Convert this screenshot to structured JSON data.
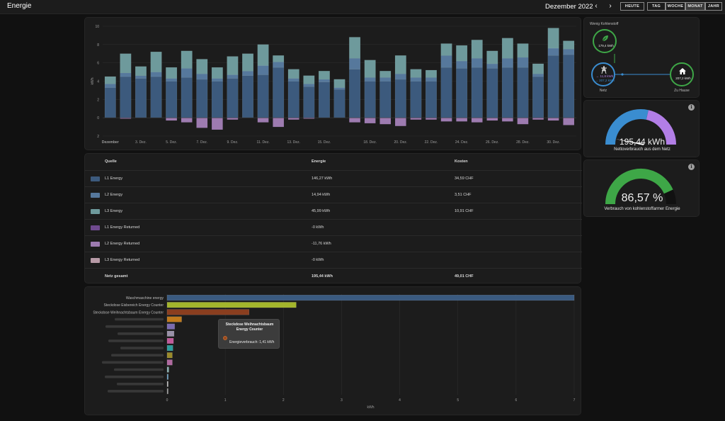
{
  "header": {
    "title": "Energie",
    "period": "Dezember 2022",
    "prev_icon": "chevron-left-icon",
    "next_icon": "chevron-right-icon",
    "prev_glyph": "‹",
    "next_glyph": "›",
    "today_label": "HEUTE",
    "ranges": [
      "TAG",
      "WOCHE",
      "MONAT",
      "JAHR"
    ],
    "active_range": "MONAT"
  },
  "chart_data": [
    {
      "type": "bar",
      "stacked": true,
      "ylabel": "kWh",
      "ylim": [
        -2,
        10
      ],
      "yticks": [
        10,
        8,
        6,
        4,
        2,
        0,
        2
      ],
      "grid": true,
      "x_first_label": "Dezember",
      "x_tick_labels": [
        "Dezember",
        "3. Dez.",
        "5. Dez.",
        "7. Dez.",
        "9. Dez.",
        "11. Dez.",
        "13. Dez.",
        "15. Dez.",
        "18. Dez.",
        "20. Dez.",
        "22. Dez.",
        "24. Dez.",
        "26. Dez.",
        "28. Dez.",
        "30. Dez."
      ],
      "x_tick_days": [
        1,
        3,
        5,
        7,
        9,
        11,
        13,
        15,
        18,
        20,
        22,
        24,
        26,
        28,
        30
      ],
      "days": [
        1,
        2,
        3,
        4,
        5,
        6,
        7,
        8,
        9,
        10,
        11,
        12,
        13,
        14,
        15,
        16,
        17,
        18,
        19,
        20,
        21,
        22,
        23,
        24,
        25,
        26,
        27,
        28,
        29,
        30,
        31
      ],
      "series": [
        {
          "name": "L1 Energy",
          "color": "#3c5a7d",
          "values": [
            3.3,
            4.5,
            4.3,
            4.5,
            4.0,
            4.4,
            4.2,
            4.0,
            4.3,
            4.6,
            4.7,
            5.5,
            4.0,
            3.4,
            3.9,
            3.1,
            5.3,
            4.0,
            4.0,
            4.2,
            4.0,
            4.0,
            5.5,
            5.4,
            5.5,
            5.4,
            5.5,
            5.5,
            4.5,
            6.8,
            6.9
          ]
        },
        {
          "name": "L2 Energy",
          "color": "#56789c",
          "values": [
            0.4,
            0.4,
            0.3,
            0.5,
            0.3,
            1.0,
            0.6,
            0.3,
            0.4,
            0.5,
            1.0,
            0.6,
            0.3,
            0.3,
            0.3,
            0.2,
            1.2,
            0.4,
            0.4,
            0.6,
            0.4,
            0.4,
            1.3,
            0.8,
            1.0,
            0.5,
            1.0,
            1.1,
            0.3,
            0.8,
            0.6
          ]
        },
        {
          "name": "L3 Energy",
          "color": "#6e9a9c",
          "values": [
            0.8,
            2.1,
            1.0,
            2.2,
            1.2,
            1.9,
            1.6,
            1.2,
            2.0,
            1.9,
            2.3,
            0.7,
            1.0,
            0.9,
            0.9,
            0.9,
            2.3,
            1.9,
            0.7,
            2.0,
            0.9,
            0.8,
            1.3,
            1.7,
            2.0,
            1.4,
            2.2,
            1.5,
            1.1,
            2.2,
            0.9
          ]
        },
        {
          "name": "L1 Energy Returned",
          "color": "#6f4a8e",
          "values": [
            0,
            0,
            0,
            0,
            0,
            0,
            0,
            0,
            0,
            0,
            0,
            0,
            0,
            0,
            0,
            0,
            0,
            0,
            0,
            0,
            0,
            0,
            0,
            0,
            0,
            0,
            0,
            0,
            0,
            0,
            0
          ]
        },
        {
          "name": "L2 Energy Returned",
          "color": "#9d7bb0",
          "values": [
            0,
            -0.1,
            0,
            0,
            -0.3,
            -0.5,
            -1.1,
            -1.3,
            -0.2,
            0,
            -0.5,
            -1.0,
            -0.2,
            -0.1,
            0,
            0,
            -0.5,
            -0.6,
            -0.7,
            -0.9,
            -0.2,
            -0.2,
            -0.4,
            -0.4,
            -0.5,
            -0.3,
            -0.4,
            -0.7,
            -0.2,
            -0.3,
            -0.8
          ]
        },
        {
          "name": "L3 Energy Returned",
          "color": "#b79aa6",
          "values": [
            0,
            0,
            0,
            0,
            0,
            0,
            0,
            0,
            0,
            0,
            0,
            0,
            0,
            0,
            0,
            0,
            0,
            0,
            0,
            0,
            0,
            0,
            0,
            0,
            0,
            0,
            0,
            0,
            0,
            0,
            0
          ]
        }
      ]
    },
    {
      "type": "bar",
      "orientation": "horizontal",
      "xlabel": "kWh",
      "xlim": [
        0,
        7
      ],
      "xticks": [
        0,
        1,
        2,
        3,
        4,
        5,
        6,
        7
      ],
      "grid": true,
      "categories": [
        "Waschmaschine energy",
        "Steckdose Eisbereich Energy Counter",
        "Steckdose Weihnachtsbaum Energy Counter",
        "",
        "",
        "",
        "",
        "",
        "",
        "",
        "",
        "",
        "",
        ""
      ],
      "values": [
        7.0,
        2.22,
        1.41,
        0.25,
        0.13,
        0.12,
        0.11,
        0.1,
        0.09,
        0.09,
        0.03,
        0.02,
        0.01,
        0.0
      ],
      "colors": [
        "#3a5a80",
        "#a3b52c",
        "#8a3e1f",
        "#c07a1c",
        "#7a6bb0",
        "#9a92a8",
        "#c05a9a",
        "#2e9c9c",
        "#9a8a2a",
        "#b06aa0",
        "#8ab0b0",
        "#6aa0c0",
        "#c0c0c0",
        "#a0a0a0"
      ]
    }
  ],
  "table": {
    "headers": {
      "source": "Quelle",
      "energy": "Energie",
      "cost": "Kosten"
    },
    "rows": [
      {
        "name": "L1 Energy",
        "energy": "146,27 kWh",
        "cost": "34,59 CHF",
        "color": "#3c5a7d"
      },
      {
        "name": "L2 Energy",
        "energy": "14,94 kWh",
        "cost": "3,51 CHF",
        "color": "#56789c"
      },
      {
        "name": "L3 Energy",
        "energy": "45,99 kWh",
        "cost": "10,91 CHF",
        "color": "#6e9a9c"
      },
      {
        "name": "L1 Energy Returned",
        "energy": "-0 kWh",
        "cost": "",
        "color": "#6f4a8e"
      },
      {
        "name": "L2 Energy Returned",
        "energy": "-11,76 kWh",
        "cost": "",
        "color": "#9d7bb0"
      },
      {
        "name": "L3 Energy Returned",
        "energy": "-0 kWh",
        "cost": "",
        "color": "#b79aa6"
      }
    ],
    "total": {
      "name": "Netz gesamt",
      "energy": "195,44 kWh",
      "cost": "49,01 CHF"
    }
  },
  "tooltip": {
    "title_line1": "Steckdose Weihnachtsbaum",
    "title_line2": "Energy Counter",
    "line": "Energieverbrauch: 1,41 kWh"
  },
  "distribution": {
    "low_carbon_label": "Wenig Kohlenstoff",
    "low_carbon_value": "179,4 kWh",
    "grid_in": "← 11,8 kWh",
    "grid_out": "→ 207,2 kWh",
    "grid_label": "Netz",
    "home_value": "207,2 kWh",
    "home_label": "Zu Hause",
    "icons": {
      "leaf": "leaf-icon",
      "grid": "transmission-tower-icon",
      "home": "home-icon"
    }
  },
  "gauge_net": {
    "value": "195,44 kWh",
    "label": "Nettoverbrauch aus dem Netz",
    "import_fraction": 0.57,
    "import_color": "#3a8dd0",
    "export_color": "#b27ee6"
  },
  "gauge_low_carbon": {
    "value": "86,57 %",
    "label": "Verbrauch von kohlenstoffarmer Energie",
    "fraction": 0.8657,
    "color": "#3ea747",
    "track_color": "#111111"
  },
  "info_glyph": "i"
}
